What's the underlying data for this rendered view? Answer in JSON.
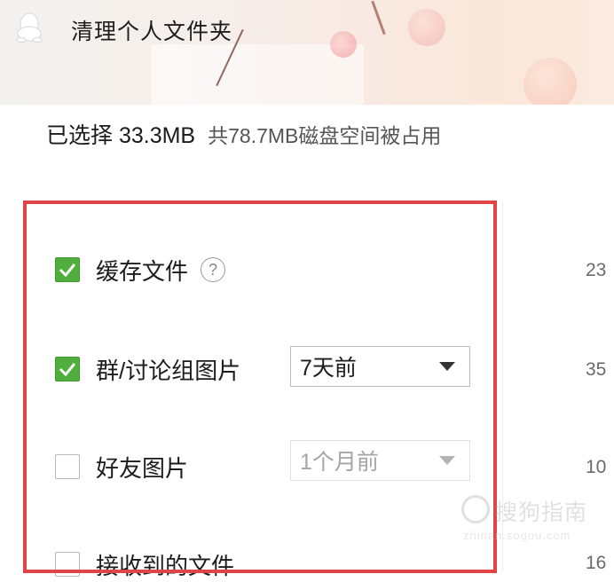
{
  "window": {
    "title": "清理个人文件夹"
  },
  "summary": {
    "selected": "已选择 33.3MB",
    "total": "共78.7MB磁盘空间被占用"
  },
  "items": [
    {
      "label": "缓存文件",
      "checked": true,
      "size": "23"
    },
    {
      "label": "群/讨论组图片",
      "checked": true,
      "dropdown": "7天前",
      "size": "35"
    },
    {
      "label": "好友图片",
      "checked": false,
      "dropdown": "1个月前",
      "size": "10"
    },
    {
      "label": "接收到的文件",
      "checked": false,
      "size": "16"
    }
  ],
  "watermark": {
    "text": "搜狗指南",
    "url": "zhinan.sogou.com"
  },
  "colors": {
    "accent": "#4fae3d",
    "highlight": "#e04545"
  }
}
